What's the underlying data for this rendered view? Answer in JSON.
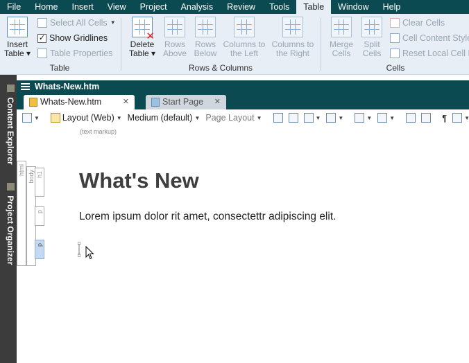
{
  "menubar": {
    "items": [
      "File",
      "Home",
      "Insert",
      "View",
      "Project",
      "Analysis",
      "Review",
      "Tools",
      "Table",
      "Window",
      "Help"
    ],
    "active": "Table"
  },
  "ribbon": {
    "table_group": {
      "label": "Table",
      "insert_table": [
        "Insert",
        "Table ▾"
      ],
      "select_all_cells": "Select All Cells",
      "show_gridlines": "Show Gridlines",
      "show_gridlines_checked": true,
      "table_properties": "Table Properties"
    },
    "rows_columns_group": {
      "label": "Rows & Columns",
      "delete_table": [
        "Delete",
        "Table ▾"
      ],
      "rows_above": [
        "Rows",
        "Above"
      ],
      "rows_below": [
        "Rows",
        "Below"
      ],
      "columns_left": [
        "Columns to",
        "the Left"
      ],
      "columns_right": [
        "Columns to",
        "the Right"
      ]
    },
    "cells_group": {
      "label": "Cells",
      "merge_cells": [
        "Merge",
        "Cells"
      ],
      "split_cells": [
        "Split",
        "Cells"
      ],
      "clear_cells": "Clear Cells",
      "cell_content_style": "Cell Content Style",
      "reset_local_cell": "Reset Local Cell Fo"
    }
  },
  "dock": {
    "content_explorer": "Content Explorer",
    "project_organizer": "Project Organizer"
  },
  "document": {
    "title": "Whats-New.htm",
    "tabs": [
      {
        "label": "Whats-New.htm",
        "close": "✕"
      },
      {
        "label": "Start Page",
        "close": "✕"
      }
    ],
    "toolbar": {
      "layout": "Layout (Web)",
      "medium": "Medium (default)",
      "page_layout": "Page Layout"
    },
    "markup_label": "(text markup)",
    "structure_labels": [
      "html",
      "body",
      "h1",
      "p",
      "p"
    ],
    "heading": "What's New",
    "paragraph": "Lorem ipsum dolor rit amet, consectettr adipiscing elit."
  },
  "colors": {
    "titlebar": "#0b4a50",
    "ribbon_bg": "#e7eef6",
    "dock_bg": "#3c3c3c",
    "selected_block": "#c5daf0"
  }
}
